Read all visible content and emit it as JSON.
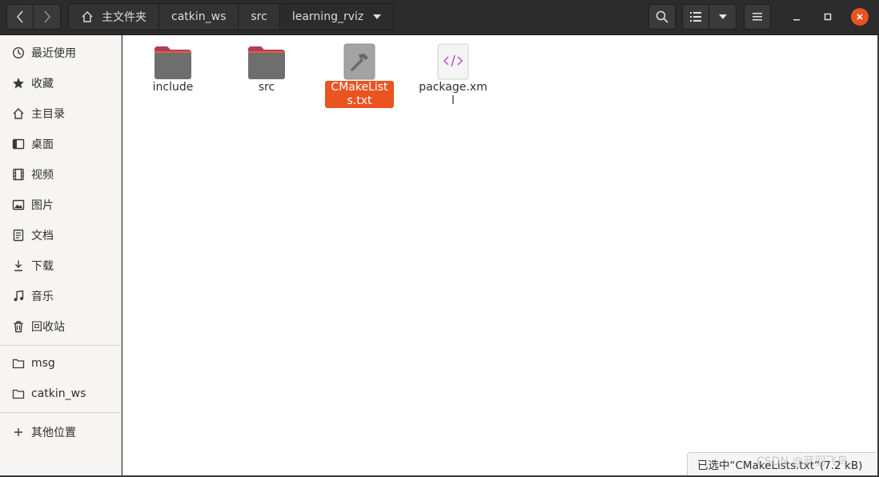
{
  "pathbar": {
    "crumbs": [
      "主文件夹",
      "catkin_ws",
      "src",
      "learning_rviz"
    ]
  },
  "sidebar": {
    "items": [
      {
        "label": "最近使用",
        "icon": "clock-icon"
      },
      {
        "label": "收藏",
        "icon": "star-icon"
      },
      {
        "label": "主目录",
        "icon": "home-icon"
      },
      {
        "label": "桌面",
        "icon": "desktop-icon"
      },
      {
        "label": "视频",
        "icon": "film-icon"
      },
      {
        "label": "图片",
        "icon": "image-icon"
      },
      {
        "label": "文档",
        "icon": "document-icon"
      },
      {
        "label": "下载",
        "icon": "download-icon"
      },
      {
        "label": "音乐",
        "icon": "music-icon"
      },
      {
        "label": "回收站",
        "icon": "trash-icon"
      }
    ],
    "bookmarks": [
      {
        "label": "msg",
        "icon": "folder-icon"
      },
      {
        "label": "catkin_ws",
        "icon": "folder-icon"
      }
    ],
    "other": {
      "label": "其他位置",
      "icon": "plus-icon"
    }
  },
  "files": [
    {
      "name": "include",
      "type": "folder-icon"
    },
    {
      "name": "src",
      "type": "folder-icon"
    },
    {
      "name": "CMakeLists.txt",
      "type": "hammer-icon",
      "selected": true
    },
    {
      "name": "package.xml",
      "type": "xml-icon"
    }
  ],
  "status": {
    "text": "已选中“CMakeLists.txt”(7.2 kB)"
  },
  "watermark": "CSDN @蓝羽飞鸟",
  "colors": {
    "accent": "#e95420",
    "headerbar": "#2c2c2c",
    "sidebar": "#f6f5f4",
    "folder_top": "#b83a5a",
    "folder_body": "#6e6e6e"
  }
}
